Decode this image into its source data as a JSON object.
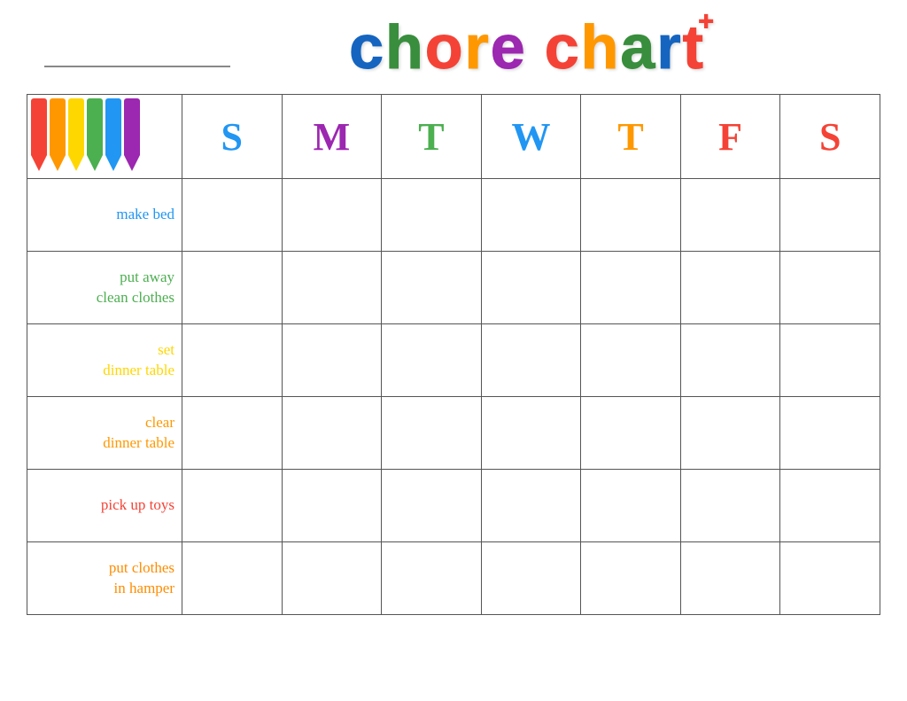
{
  "header": {
    "name_placeholder": "___________",
    "title_word1": "chore",
    "title_word2": "chart"
  },
  "days": [
    {
      "label": "S",
      "color_class": "day-S1"
    },
    {
      "label": "M",
      "color_class": "day-M"
    },
    {
      "label": "T",
      "color_class": "day-T1"
    },
    {
      "label": "W",
      "color_class": "day-W"
    },
    {
      "label": "T",
      "color_class": "day-T2"
    },
    {
      "label": "F",
      "color_class": "day-F"
    },
    {
      "label": "S",
      "color_class": "day-S2"
    }
  ],
  "chores": [
    {
      "label": "make bed",
      "color_class": "chore-make-bed"
    },
    {
      "label": "put away\nclean clothes",
      "color_class": "chore-putaway"
    },
    {
      "label": "set\ndinner table",
      "color_class": "chore-set-dinner"
    },
    {
      "label": "clear\ndinner table",
      "color_class": "chore-clear-dinner"
    },
    {
      "label": "pick up toys",
      "color_class": "chore-pickup-toys"
    },
    {
      "label": "put clothes\nin hamper",
      "color_class": "chore-put-clothes"
    }
  ],
  "crayons": [
    {
      "color": "#F44336"
    },
    {
      "color": "#FF9800"
    },
    {
      "color": "#FFD700"
    },
    {
      "color": "#4CAF50"
    },
    {
      "color": "#2196F3"
    },
    {
      "color": "#9C27B0"
    }
  ]
}
